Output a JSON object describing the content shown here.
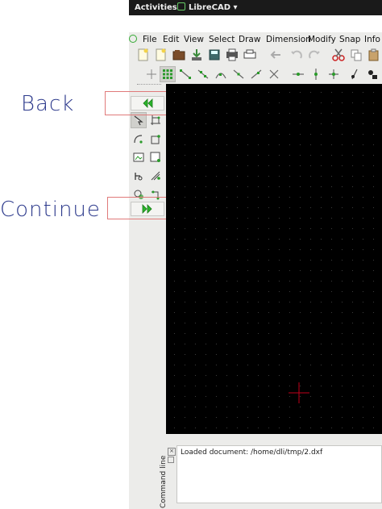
{
  "annotations": {
    "back_label": "Back",
    "continue_label": "Continue"
  },
  "topbar": {
    "activities": "Activities",
    "app_name": "LibreCAD ▾"
  },
  "menu": {
    "items": [
      "File",
      "Edit",
      "View",
      "Select",
      "Draw",
      "Dimension",
      "Modify",
      "Snap",
      "Info"
    ]
  },
  "command": {
    "side_label": "Command line",
    "log_text": "Loaded document: /home/dli/tmp/2.dxf"
  },
  "colors": {
    "annotation_text": "#2d3a8c",
    "annotation_box": "#e07a7a",
    "canvas_bg": "#000000",
    "crosshair": "#c0001a",
    "nav_green": "#2bb52b"
  },
  "icons": {
    "back": "double-chevron-left-icon",
    "continue": "double-chevron-right-icon"
  }
}
